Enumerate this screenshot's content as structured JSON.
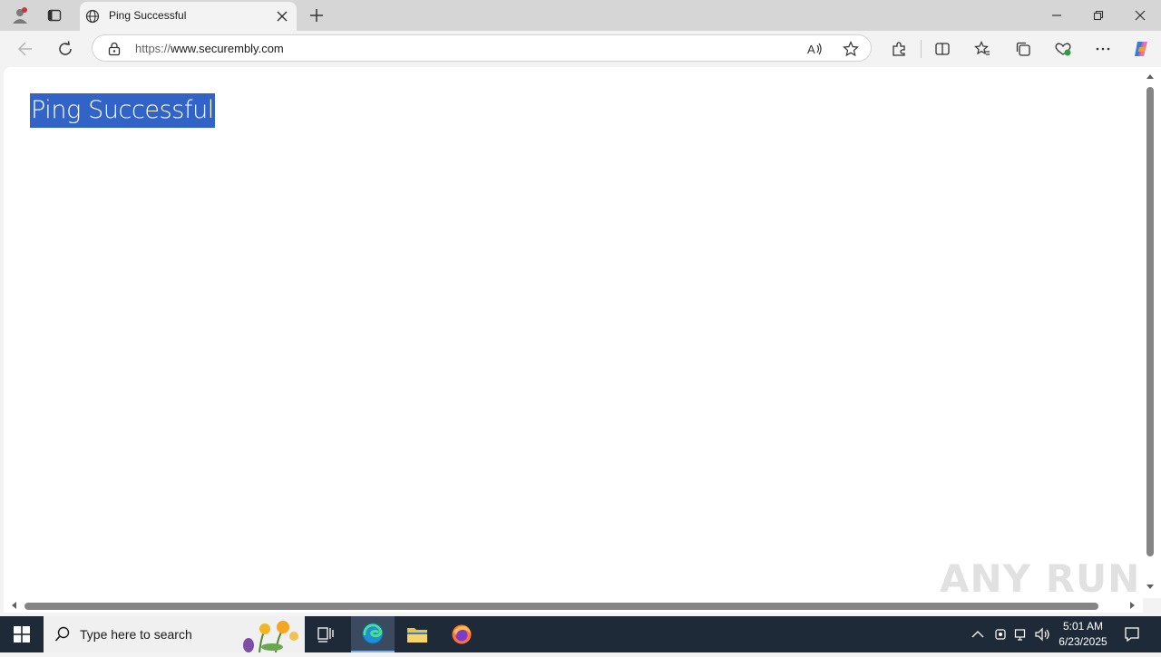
{
  "browser": {
    "tab": {
      "title": "Ping Successful"
    },
    "address": {
      "url_proto": "https://",
      "url_host": "www.securembly.com"
    }
  },
  "page": {
    "heading": "Ping Successful"
  },
  "watermark": {
    "text": "ANY RUN"
  },
  "taskbar": {
    "search_placeholder": "Type here to search",
    "clock_time": "5:01 AM",
    "clock_date": "6/23/2025"
  },
  "colors": {
    "selection": "#3264c8",
    "taskbar": "#1f2a38",
    "tabbar": "#d6d6d6"
  }
}
